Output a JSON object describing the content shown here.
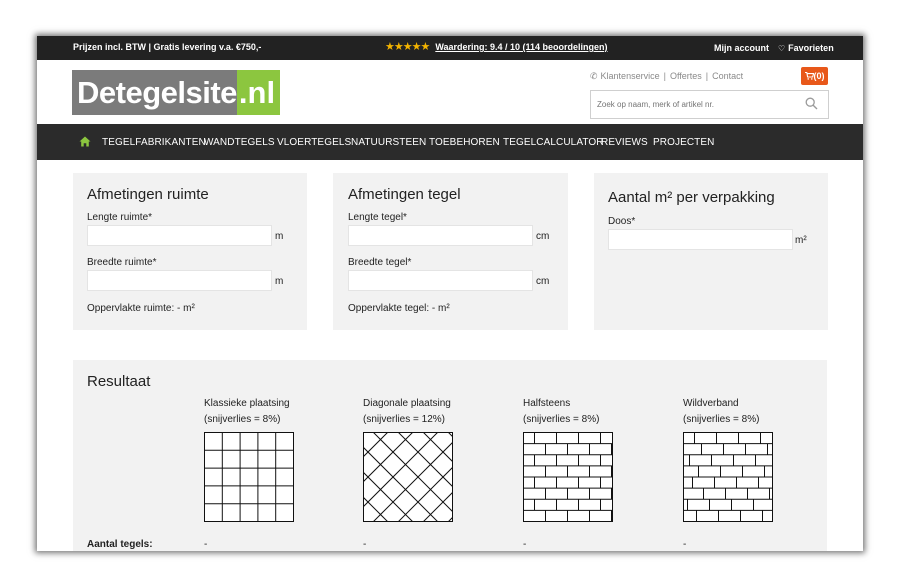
{
  "topbar": {
    "prices_text": "Prijzen incl. BTW | Gratis levering v.a. €750,-",
    "stars": "★★★★★",
    "rating_text": "Waardering: 9.4 / 10 (114 beoordelingen)",
    "account_label": "Mijn account",
    "favorites_label": "Favorieten"
  },
  "header": {
    "logo_main": "Detegelsite",
    "logo_ext": ".nl",
    "links": {
      "service": "Klantenservice",
      "quotes": "Offertes",
      "contact": "Contact",
      "separator": "|"
    },
    "cart_label": "(0)",
    "search_placeholder": "Zoek op naam, merk of artikel nr."
  },
  "nav": {
    "items": [
      "TEGELFABRIKANTEN",
      "WANDTEGELS",
      "VLOERTEGELS",
      "NATUURSTEEN",
      "TOEBEHOREN",
      "TEGELCALCULATOR",
      "REVIEWS",
      "PROJECTEN"
    ]
  },
  "room": {
    "title": "Afmetingen ruimte",
    "length_label": "Lengte ruimte*",
    "width_label": "Breedte ruimte*",
    "unit": "m",
    "area_text": "Oppervlakte ruimte: - m²"
  },
  "tile": {
    "title": "Afmetingen tegel",
    "length_label": "Lengte tegel*",
    "width_label": "Breedte tegel*",
    "unit": "cm",
    "area_text": "Oppervlakte tegel: - m²"
  },
  "package": {
    "title": "Aantal m² per verpakking",
    "box_label": "Doos*",
    "unit": "m²"
  },
  "result": {
    "title": "Resultaat",
    "patterns": [
      {
        "name": "Klassieke plaatsing",
        "waste": "(snijverlies = 8%)",
        "tiles": "-"
      },
      {
        "name": "Diagonale plaatsing",
        "waste": "(snijverlies = 12%)",
        "tiles": "-"
      },
      {
        "name": "Halfsteens",
        "waste": "(snijverlies = 8%)",
        "tiles": "-"
      },
      {
        "name": "Wildverband",
        "waste": "(snijverlies = 8%)",
        "tiles": "-"
      }
    ],
    "tiles_label": "Aantal tegels:"
  },
  "colors": {
    "topbar_bg": "#222222",
    "nav_bg": "#2b2b2b",
    "accent_green": "#8cc63f",
    "cart_orange": "#e8581a",
    "stars": "#f4b400",
    "panel_bg": "#f2f2f2"
  }
}
